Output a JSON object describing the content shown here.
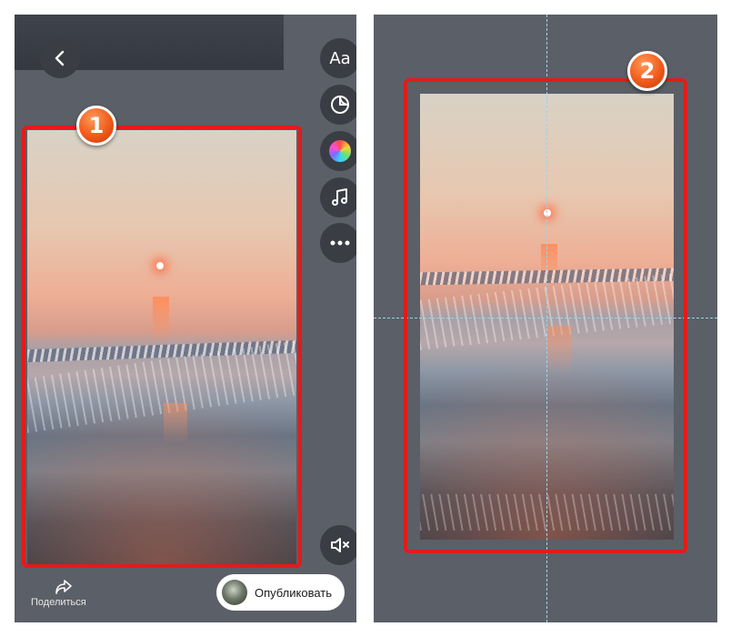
{
  "left_editor": {
    "tools": [
      {
        "name": "text-tool",
        "label": "Aa"
      },
      {
        "name": "sticker-tool",
        "icon": "sticker-icon"
      },
      {
        "name": "color-tool",
        "icon": "color-wheel-icon"
      },
      {
        "name": "music-tool",
        "icon": "music-note-icon"
      },
      {
        "name": "more-tool",
        "icon": "more-dots-icon"
      }
    ],
    "back_icon": "chevron-left-icon",
    "mute_icon": "speaker-muted-icon",
    "share": {
      "label": "Поделиться",
      "icon": "share-arrow-icon"
    },
    "publish": {
      "label": "Опубликовать"
    }
  },
  "annotations": {
    "badge_1": "1",
    "badge_2": "2",
    "highlight_color": "#e21b1b",
    "badge_color": "#f05a1a"
  },
  "guides_color": "#9fd2e8",
  "panel_color": "#5b5f67"
}
